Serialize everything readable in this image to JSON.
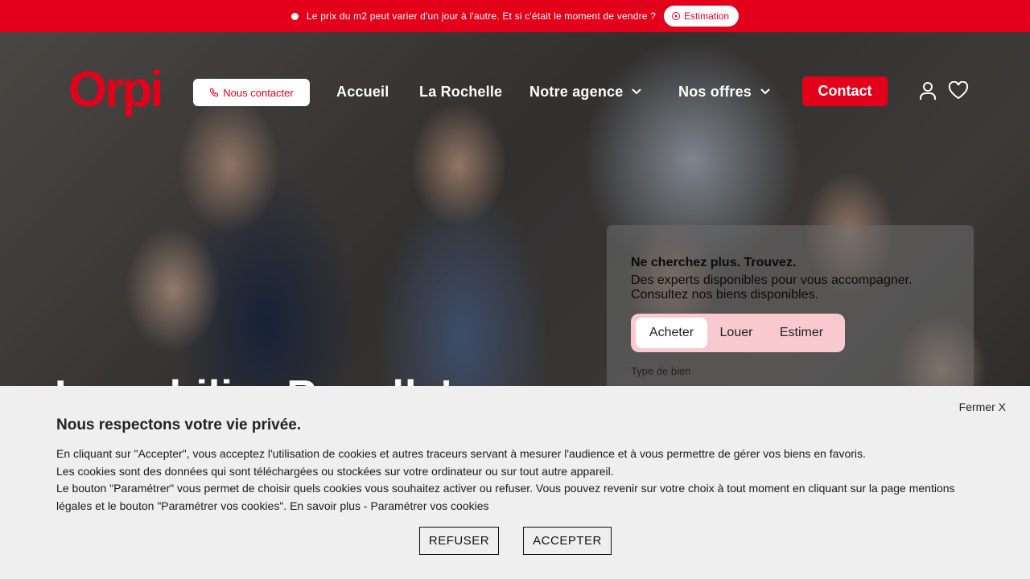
{
  "announcement": {
    "message": "Le prix du m2 peut varier d'un jour à l'autre. Et si c'était le moment de vendre ?",
    "button_label": "Estimation"
  },
  "header": {
    "logo_text": "Orpi",
    "contact_pill": "Nous contacter",
    "nav": [
      {
        "label": "Accueil"
      },
      {
        "label": "La Rochelle"
      },
      {
        "label": "Notre agence"
      },
      {
        "label": "Nos offres"
      }
    ],
    "contact_button": "Contact"
  },
  "hero": {
    "title": "Immobilier Royalle's"
  },
  "search": {
    "heading": "Ne cherchez plus. Trouvez.",
    "line1": "Des experts disponibles pour vous accompagner.",
    "line2": "Consultez nos biens disponibles.",
    "tabs": [
      "Acheter",
      "Louer",
      "Estimer"
    ],
    "active_tab": "Acheter",
    "field_label": "Type de bien"
  },
  "cookie": {
    "close": "Fermer X",
    "title": "Nous respectons votre vie privée.",
    "paragraph1": "En cliquant sur \"Accepter\", vous acceptez l'utilisation de cookies et autres traceurs servant à mesurer l'audience et à vous permettre de gérer vos biens en favoris.",
    "paragraph2": "Les cookies sont des données qui sont téléchargées ou stockées sur votre ordinateur ou sur tout autre appareil.",
    "paragraph3": "Le bouton \"Paramétrer\" vous permet de choisir quels cookies vous souhaitez activer ou refuser. Vous pouvez revenir sur votre choix à tout moment en cliquant sur la page mentions légales et le bouton \"Paramétrer vos cookies\". En savoir plus - Paramétrer vos cookies",
    "refuse": "REFUSER",
    "accept": "ACCEPTER"
  },
  "colors": {
    "brand_red": "#e2001a",
    "tab_bg": "#f8c9cf",
    "cookie_bg": "#efefef"
  }
}
